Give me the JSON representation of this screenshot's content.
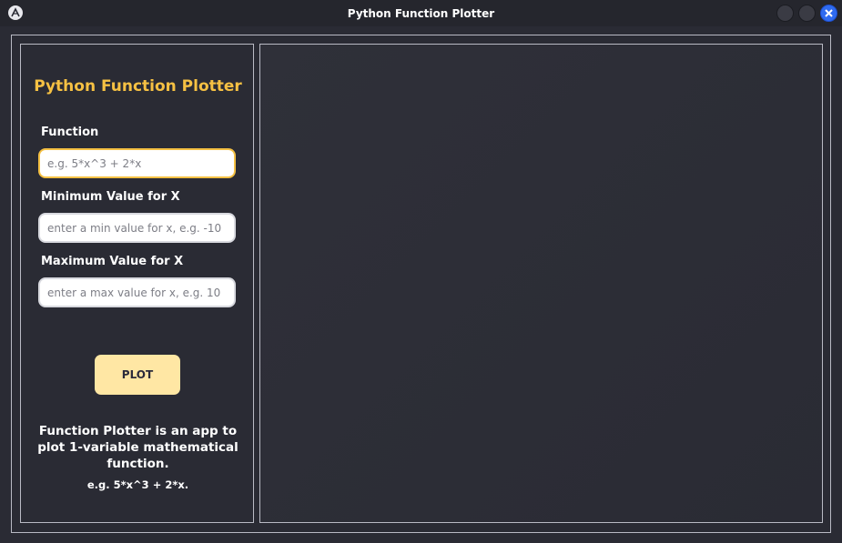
{
  "window": {
    "title": "Python Function Plotter",
    "close_glyph": "×"
  },
  "sidebar": {
    "heading": "Python Function Plotter",
    "function_label": "Function",
    "function_placeholder": "e.g. 5*x^3 + 2*x",
    "function_value": "",
    "min_label": "Minimum Value for X",
    "min_placeholder": "enter a min value for x, e.g. -10",
    "min_value": "",
    "max_label": "Maximum Value for X",
    "max_placeholder": "enter a max value for x, e.g. 10",
    "max_value": "",
    "plot_label": "PLOT",
    "about_text": "Function Plotter is an app to plot 1-variable mathematical function.",
    "example_text": "e.g.  5*x^3 + 2*x."
  },
  "colors": {
    "accent": "#f6c143",
    "button": "#ffe7a4",
    "background": "#2a2b34",
    "close_button": "#2f6bf0"
  },
  "icons": {
    "app": "app-logo-icon",
    "minimize": "minimize-icon",
    "maximize": "maximize-icon",
    "close": "close-icon"
  }
}
